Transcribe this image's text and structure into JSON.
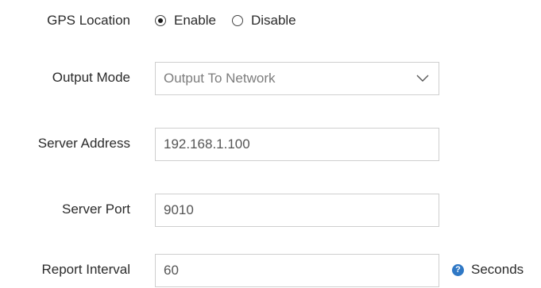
{
  "gps_location": {
    "label": "GPS Location",
    "options": [
      {
        "label": "Enable",
        "selected": true
      },
      {
        "label": "Disable",
        "selected": false
      }
    ]
  },
  "output_mode": {
    "label": "Output Mode",
    "selected_value": "Output To Network"
  },
  "server_address": {
    "label": "Server Address",
    "value": "192.168.1.100"
  },
  "server_port": {
    "label": "Server Port",
    "value": "9010"
  },
  "report_interval": {
    "label": "Report Interval",
    "value": "60",
    "help_icon": "?",
    "unit": "Seconds"
  },
  "colors": {
    "text": "#2b2b2b",
    "field_border": "#cfcfcf",
    "select_text": "#7d7d7d",
    "help_icon_bg": "#2f78c5"
  },
  "icons": {
    "dropdown": "chevron-down-icon",
    "help": "help-icon"
  }
}
